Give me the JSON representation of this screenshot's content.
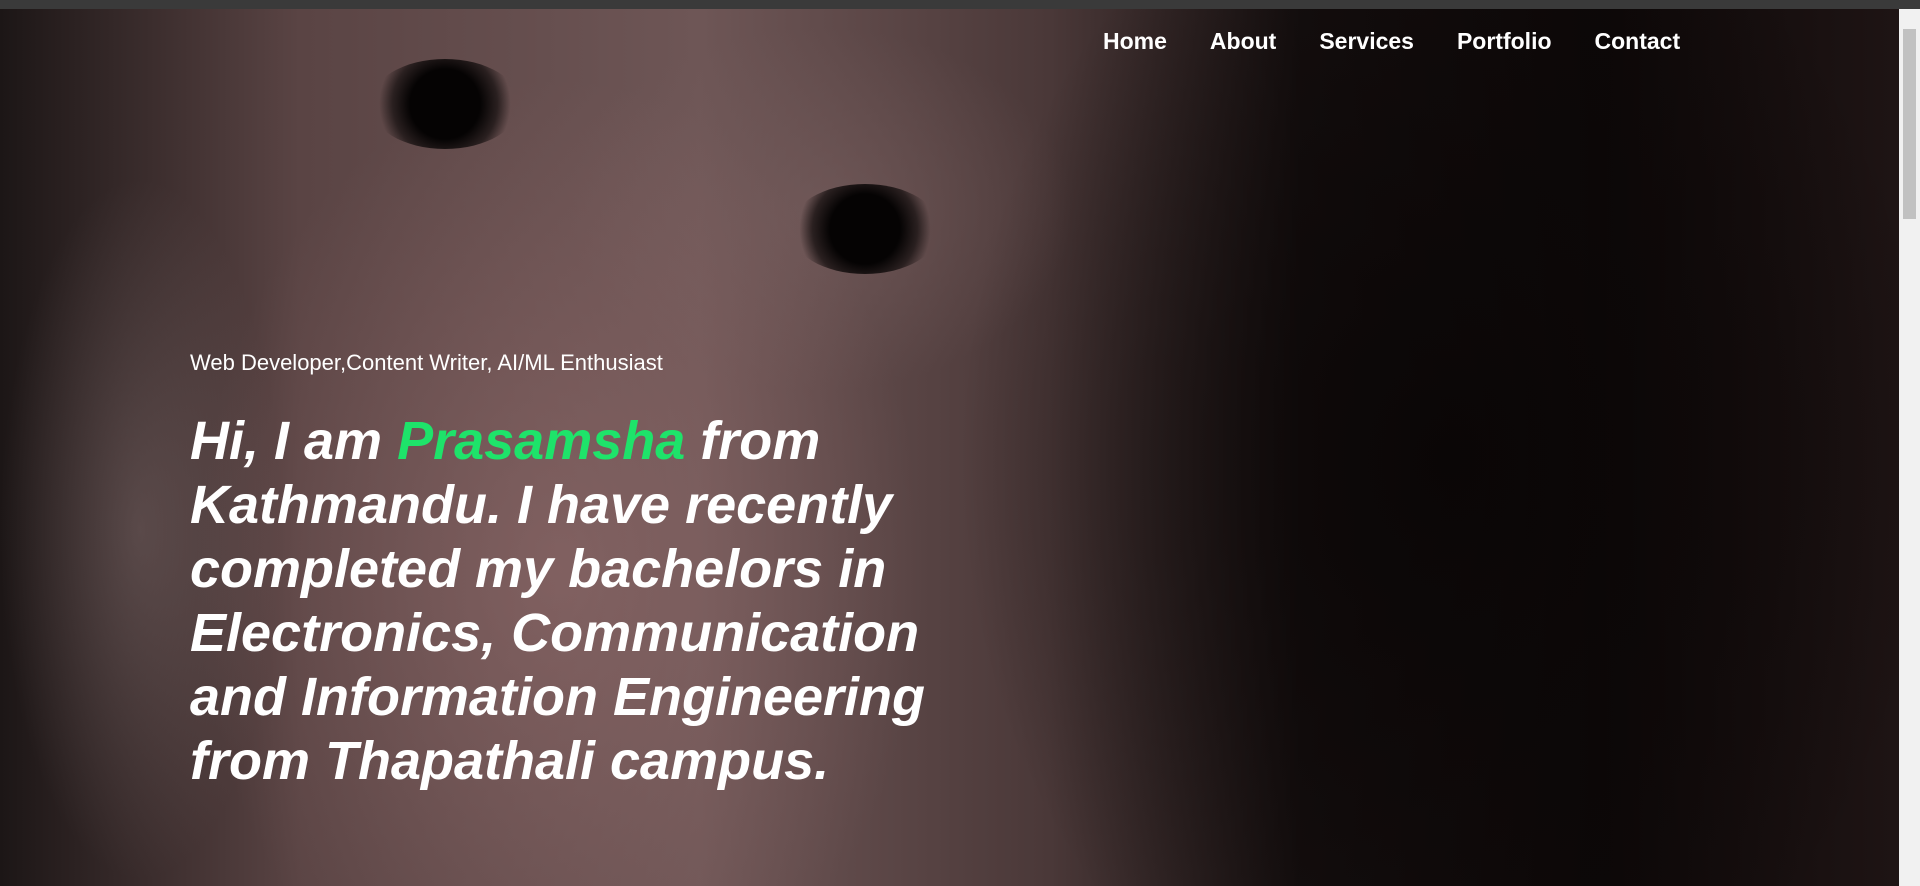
{
  "nav": {
    "items": [
      "Home",
      "About",
      "Services",
      "Portfolio",
      "Contact"
    ]
  },
  "hero": {
    "tagline": "Web Developer,Content Writer, AI/ML Enthusiast",
    "headline_pre": "Hi, I am ",
    "name": "Prasamsha",
    "headline_post": " from Kathmandu. I have recently completed my bachelors in Electronics, Communication and Information Engineering from Thapathali campus."
  },
  "colors": {
    "accent": "#1ee36a",
    "text": "#ffffff"
  }
}
